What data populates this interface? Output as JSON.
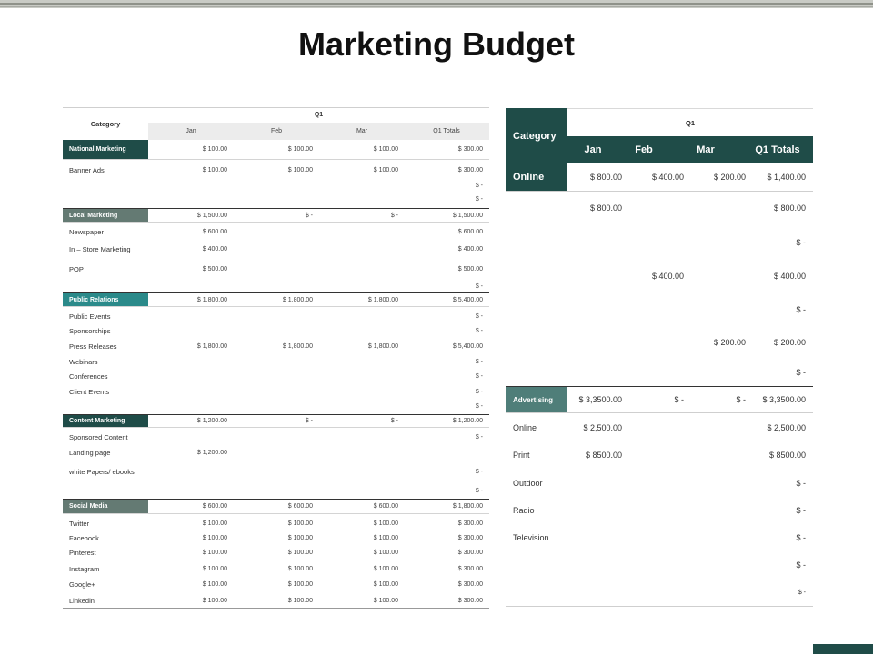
{
  "title": "Marketing Budget",
  "colors": {
    "dark_teal": "#1f4c48",
    "grey_green": "#647a73",
    "teal": "#2b8a8a",
    "mid_teal": "#4f7e79"
  },
  "left_table": {
    "category_header": "Category",
    "q1_header": "Q1",
    "columns": [
      "Jan",
      "Feb",
      "Mar",
      "Q1 Totals"
    ],
    "rows": [
      {
        "label": "National Marketing",
        "type": "section",
        "color": "#1f4c48",
        "cells": [
          "$ 100.00",
          "$ 100.00",
          "$ 100.00",
          "$ 300.00"
        ]
      },
      {
        "label": "Banner  Ads",
        "type": "item",
        "cells": [
          "$ 100.00",
          "$ 100.00",
          "$ 100.00",
          "$ 300.00"
        ]
      },
      {
        "label": "",
        "type": "item",
        "cells": [
          "",
          "",
          "",
          "$ -"
        ]
      },
      {
        "label": "",
        "type": "item",
        "cells": [
          "",
          "",
          "",
          "$ -"
        ]
      },
      {
        "label": "Local Marketing",
        "type": "section",
        "color": "#647a73",
        "cells": [
          "$ 1,500.00",
          "$ -",
          "$ -",
          "$ 1,500.00"
        ]
      },
      {
        "label": "Newspaper",
        "type": "item",
        "cells": [
          "$ 600.00",
          "",
          "",
          "$ 600.00"
        ]
      },
      {
        "label": "In – Store  Marketing",
        "type": "item",
        "cells": [
          "$ 400.00",
          "",
          "",
          "$ 400.00"
        ]
      },
      {
        "label": "POP",
        "type": "item",
        "cells": [
          "$ 500.00",
          "",
          "",
          "$ 500.00"
        ]
      },
      {
        "label": "",
        "type": "item",
        "cells": [
          "",
          "",
          "",
          "$ -"
        ]
      },
      {
        "label": "Public Relations",
        "type": "section",
        "color": "#2b8a8a",
        "cells": [
          "$ 1,800.00",
          "$ 1,800.00",
          "$ 1,800.00",
          "$ 5,400.00"
        ]
      },
      {
        "label": "Public Events",
        "type": "item",
        "cells": [
          "",
          "",
          "",
          "$ -"
        ]
      },
      {
        "label": "Sponsorships",
        "type": "item",
        "cells": [
          "",
          "",
          "",
          "$ -"
        ]
      },
      {
        "label": "Press Releases",
        "type": "item",
        "cells": [
          "$ 1,800.00",
          "$ 1,800.00",
          "$ 1,800.00",
          "$ 5,400.00"
        ]
      },
      {
        "label": "Webinars",
        "type": "item",
        "cells": [
          "",
          "",
          "",
          "$ -"
        ]
      },
      {
        "label": "Conferences",
        "type": "item",
        "cells": [
          "",
          "",
          "",
          "$ -"
        ]
      },
      {
        "label": "Client Events",
        "type": "item",
        "cells": [
          "",
          "",
          "",
          "$ -"
        ]
      },
      {
        "label": "",
        "type": "item",
        "cells": [
          "",
          "",
          "",
          "$ -"
        ]
      },
      {
        "label": "Content Marketing",
        "type": "section",
        "color": "#1f4c48",
        "cells": [
          "$ 1,200.00",
          "$ -",
          "$ -",
          "$ 1,200.00"
        ]
      },
      {
        "label": "Sponsored  Content",
        "type": "item",
        "cells": [
          "",
          "",
          "",
          "$ -"
        ]
      },
      {
        "label": "Landing  page",
        "type": "item",
        "cells": [
          "$ 1,200.00",
          "",
          "",
          ""
        ]
      },
      {
        "label": "white Papers/  ebooks",
        "type": "item",
        "cells": [
          "",
          "",
          "",
          "$ -"
        ]
      },
      {
        "label": "",
        "type": "item",
        "cells": [
          "",
          "",
          "",
          "$ -"
        ]
      },
      {
        "label": "Social  Media",
        "type": "section",
        "color": "#647a73",
        "cells": [
          "$ 600.00",
          "$ 600.00",
          "$ 600.00",
          "$ 1,800.00"
        ]
      },
      {
        "label": "Twitter",
        "type": "item",
        "cells": [
          "$ 100.00",
          "$ 100.00",
          "$ 100.00",
          "$ 300.00"
        ]
      },
      {
        "label": "Facebook",
        "type": "item",
        "cells": [
          "$ 100.00",
          "$ 100.00",
          "$ 100.00",
          "$ 300.00"
        ]
      },
      {
        "label": "Pinterest",
        "type": "item",
        "cells": [
          "$ 100.00",
          "$ 100.00",
          "$ 100.00",
          "$ 300.00"
        ]
      },
      {
        "label": "Instagram",
        "type": "item",
        "cells": [
          "$ 100.00",
          "$ 100.00",
          "$ 100.00",
          "$ 300.00"
        ]
      },
      {
        "label": "Google+",
        "type": "item",
        "cells": [
          "$ 100.00",
          "$ 100.00",
          "$ 100.00",
          "$ 300.00"
        ]
      },
      {
        "label": "Linkedin",
        "type": "item",
        "cells": [
          "$ 100.00",
          "$ 100.00",
          "$ 100.00",
          "$ 300.00"
        ]
      }
    ]
  },
  "right_table": {
    "category_header": "Category",
    "q1_header": "Q1",
    "columns": [
      "Jan",
      "Feb",
      "Mar",
      "Q1 Totals"
    ],
    "rows": [
      {
        "label": "Online",
        "type": "online",
        "cells": [
          "$ 800.00",
          "$ 400.00",
          "$ 200.00",
          "$ 1,400.00"
        ]
      },
      {
        "label": "",
        "type": "item",
        "cells": [
          "$ 800.00",
          "",
          "",
          "$ 800.00"
        ]
      },
      {
        "label": "",
        "type": "item",
        "cells": [
          "",
          "",
          "",
          "$ -"
        ]
      },
      {
        "label": "",
        "type": "item",
        "cells": [
          "",
          "$ 400.00",
          "",
          "$ 400.00"
        ]
      },
      {
        "label": "",
        "type": "item",
        "cells": [
          "",
          "",
          "",
          "$ -"
        ]
      },
      {
        "label": "",
        "type": "item",
        "cells": [
          "",
          "",
          "$ 200.00",
          "$ 200.00"
        ]
      },
      {
        "label": "",
        "type": "item",
        "cells": [
          "",
          "",
          "",
          "$ -"
        ]
      },
      {
        "label": "Advertising",
        "type": "adv",
        "cells": [
          "$ 3,3500.00",
          "$ -",
          "$ -",
          "$ 3,3500.00"
        ]
      },
      {
        "label": "Online",
        "type": "item",
        "cells": [
          "$ 2,500.00",
          "",
          "",
          "$ 2,500.00"
        ]
      },
      {
        "label": "Print",
        "type": "item",
        "cells": [
          "$ 8500.00",
          "",
          "",
          "$ 8500.00"
        ]
      },
      {
        "label": "Outdoor",
        "type": "item",
        "cells": [
          "",
          "",
          "",
          "$ -"
        ]
      },
      {
        "label": "Radio",
        "type": "item",
        "cells": [
          "",
          "",
          "",
          "$ -"
        ]
      },
      {
        "label": "Television",
        "type": "item",
        "cells": [
          "",
          "",
          "",
          "$ -"
        ]
      },
      {
        "label": "",
        "type": "item",
        "cells": [
          "",
          "",
          "",
          "$ -"
        ]
      },
      {
        "label": "",
        "type": "item",
        "cells": [
          "",
          "",
          "",
          "$ -"
        ]
      }
    ]
  }
}
